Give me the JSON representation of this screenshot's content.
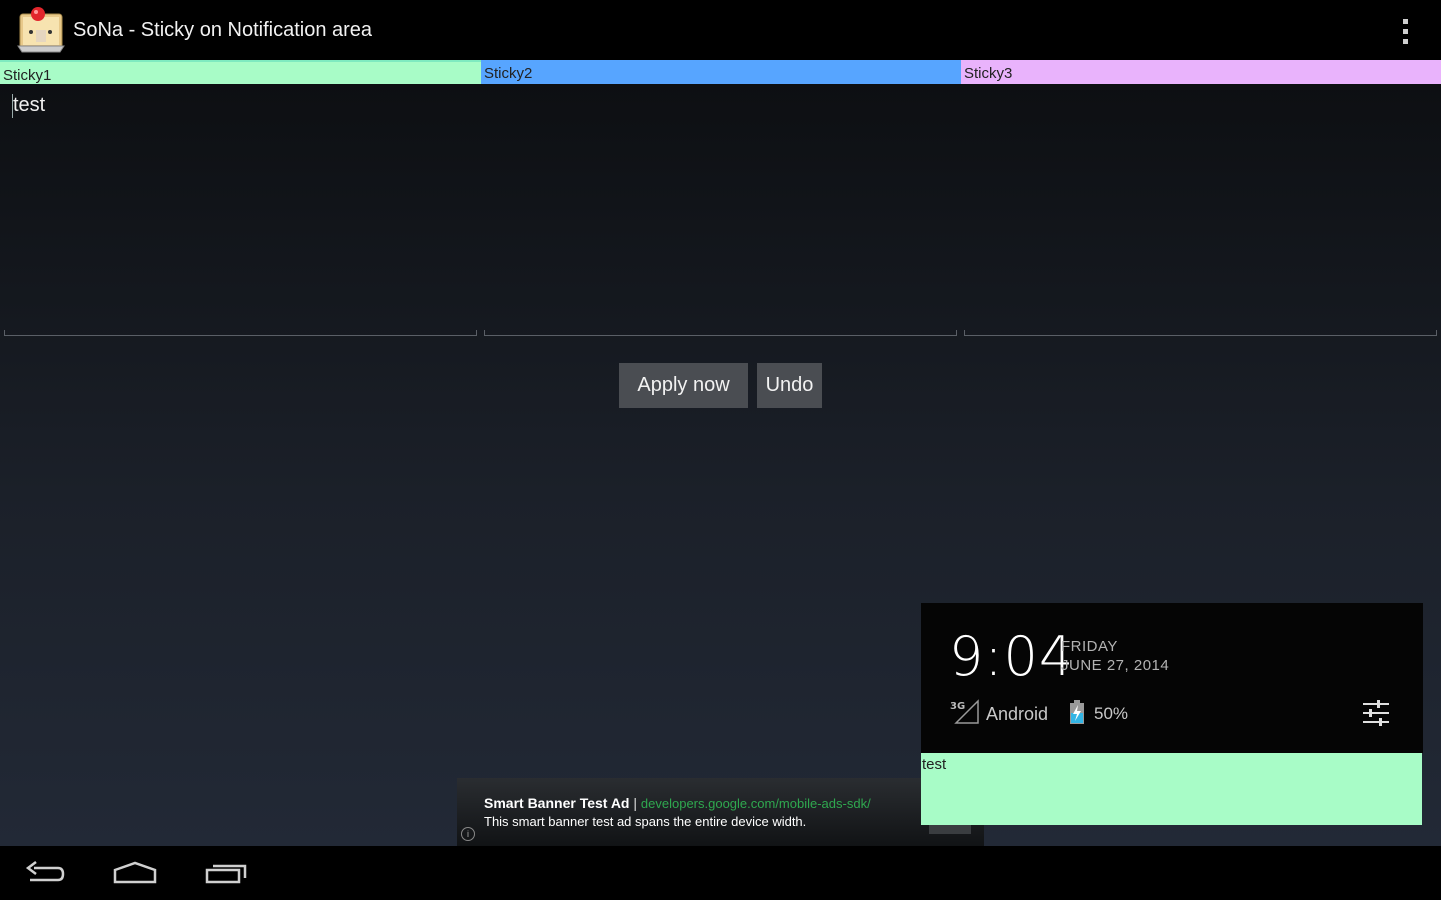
{
  "app": {
    "title": "SoNa - Sticky on Notification area",
    "icon": "sticky-note-app-icon",
    "menu_icon": "overflow-menu-icon"
  },
  "tabs": [
    {
      "label": "Sticky1",
      "color": "#a8fcc7"
    },
    {
      "label": "Sticky2",
      "color": "#57a5ff"
    },
    {
      "label": "Sticky3",
      "color": "#e9b3fc"
    }
  ],
  "notes": [
    {
      "value": "test"
    },
    {
      "value": ""
    },
    {
      "value": ""
    }
  ],
  "buttons": {
    "apply": "Apply now",
    "undo": "Undo"
  },
  "ad": {
    "title": "Smart Banner Test Ad",
    "separator": "|",
    "link": "developers.google.com/mobile-ads-sdk/",
    "description": "This smart banner test ad spans the entire device width.",
    "info": "i"
  },
  "notification_panel": {
    "time": "9:04",
    "day": "FRIDAY",
    "date": "JUNE 27, 2014",
    "network": "3G",
    "carrier": "Android",
    "battery": "50%",
    "sticky_text": "test",
    "sticky_color": "#a8fcc7"
  },
  "navigation": {
    "back_icon": "back-icon",
    "home_icon": "home-icon",
    "recent_icon": "recent-apps-icon"
  }
}
